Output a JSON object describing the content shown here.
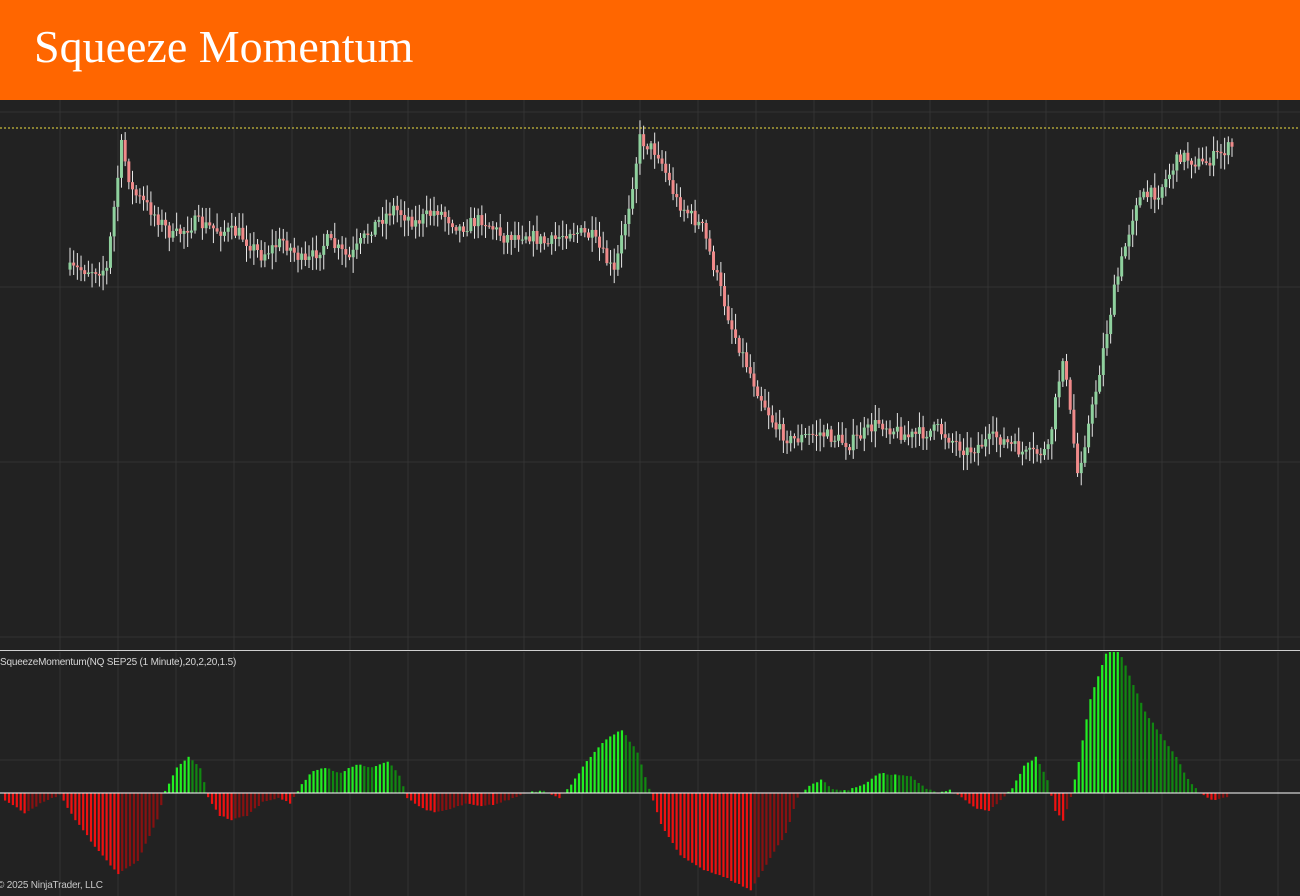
{
  "header": {
    "title": "Squeeze Momentum"
  },
  "indicator": {
    "label": "SqueezeMomentum(NQ SEP25 (1 Minute),20,2,20,1.5)"
  },
  "footer": {
    "copyright": "© 2025 NinjaTrader, LLC"
  },
  "colors": {
    "title_bar": "#ff6600",
    "background": "#222222",
    "grid": "#333333",
    "candle_up": "#8fd19e",
    "candle_down": "#f08a8a",
    "wick": "#e8e8e8",
    "reference_line": "#f0e040",
    "momentum_up_strong": "#22ee22",
    "momentum_up_weak": "#118811",
    "momentum_down_strong": "#ee1111",
    "momentum_down_weak": "#881111",
    "zero_line": "#ffffff"
  },
  "chart_data": [
    {
      "type": "candlestick",
      "symbol_interval": "1 Minute",
      "shape_keypoints": [
        [
          0,
          0.78
        ],
        [
          10,
          0.78
        ],
        [
          14,
          0.1
        ],
        [
          17,
          0.35
        ],
        [
          22,
          0.45
        ],
        [
          28,
          0.6
        ],
        [
          34,
          0.52
        ],
        [
          40,
          0.56
        ],
        [
          46,
          0.58
        ],
        [
          52,
          0.7
        ],
        [
          58,
          0.62
        ],
        [
          64,
          0.75
        ],
        [
          70,
          0.62
        ],
        [
          76,
          0.72
        ],
        [
          82,
          0.55
        ],
        [
          88,
          0.44
        ],
        [
          94,
          0.52
        ],
        [
          100,
          0.45
        ],
        [
          106,
          0.55
        ],
        [
          112,
          0.5
        ],
        [
          118,
          0.6
        ],
        [
          124,
          0.58
        ],
        [
          130,
          0.64
        ],
        [
          136,
          0.56
        ],
        [
          142,
          0.6
        ],
        [
          148,
          0.8
        ],
        [
          152,
          0.42
        ],
        [
          155,
          0.06
        ],
        [
          160,
          0.14
        ],
        [
          165,
          0.4
        ],
        [
          172,
          0.55
        ],
        [
          180,
          1.1
        ],
        [
          186,
          1.4
        ],
        [
          192,
          1.65
        ],
        [
          196,
          1.72
        ],
        [
          204,
          1.68
        ],
        [
          212,
          1.74
        ],
        [
          220,
          1.62
        ],
        [
          228,
          1.7
        ],
        [
          236,
          1.66
        ],
        [
          244,
          1.78
        ],
        [
          252,
          1.7
        ],
        [
          260,
          1.8
        ],
        [
          266,
          1.78
        ],
        [
          270,
          1.25
        ],
        [
          274,
          1.9
        ],
        [
          278,
          1.55
        ],
        [
          284,
          0.9
        ],
        [
          290,
          0.4
        ],
        [
          296,
          0.35
        ],
        [
          302,
          0.15
        ],
        [
          308,
          0.2
        ],
        [
          316,
          0.1
        ]
      ],
      "reference_line": {
        "level_ratio": 0.0
      }
    },
    {
      "type": "bar",
      "series": [
        {
          "name": "SqueezeMomentum"
        }
      ],
      "zero_line": true,
      "shape_keypoints": [
        [
          0,
          -0.08
        ],
        [
          5,
          -0.22
        ],
        [
          9,
          -0.12
        ],
        [
          14,
          -0.02
        ],
        [
          18,
          -0.3
        ],
        [
          24,
          -0.65
        ],
        [
          29,
          -0.9
        ],
        [
          34,
          -0.75
        ],
        [
          39,
          -0.3
        ],
        [
          41,
          0.02
        ],
        [
          44,
          0.28
        ],
        [
          47,
          0.4
        ],
        [
          50,
          0.28
        ],
        [
          52,
          -0.05
        ],
        [
          55,
          -0.25
        ],
        [
          58,
          -0.3
        ],
        [
          62,
          -0.25
        ],
        [
          66,
          -0.1
        ],
        [
          70,
          -0.05
        ],
        [
          73,
          -0.12
        ],
        [
          76,
          0.1
        ],
        [
          79,
          0.25
        ],
        [
          82,
          0.28
        ],
        [
          86,
          0.22
        ],
        [
          90,
          0.32
        ],
        [
          94,
          0.28
        ],
        [
          98,
          0.35
        ],
        [
          101,
          0.2
        ],
        [
          103,
          -0.05
        ],
        [
          106,
          -0.15
        ],
        [
          110,
          -0.22
        ],
        [
          114,
          -0.18
        ],
        [
          118,
          -0.12
        ],
        [
          122,
          -0.15
        ],
        [
          126,
          -0.12
        ],
        [
          130,
          -0.06
        ],
        [
          134,
          0.01
        ],
        [
          138,
          0.03
        ],
        [
          142,
          -0.06
        ],
        [
          145,
          0.1
        ],
        [
          149,
          0.35
        ],
        [
          154,
          0.6
        ],
        [
          158,
          0.7
        ],
        [
          162,
          0.45
        ],
        [
          165,
          0.05
        ],
        [
          168,
          -0.35
        ],
        [
          173,
          -0.7
        ],
        [
          179,
          -0.85
        ],
        [
          185,
          -0.95
        ],
        [
          191,
          -1.08
        ],
        [
          196,
          -0.72
        ],
        [
          200,
          -0.45
        ],
        [
          203,
          -0.05
        ],
        [
          206,
          0.08
        ],
        [
          209,
          0.15
        ],
        [
          212,
          0.04
        ],
        [
          216,
          0.03
        ],
        [
          220,
          0.1
        ],
        [
          224,
          0.22
        ],
        [
          228,
          0.2
        ],
        [
          232,
          0.18
        ],
        [
          236,
          0.05
        ],
        [
          239,
          0.0
        ],
        [
          242,
          0.03
        ],
        [
          245,
          -0.05
        ],
        [
          249,
          -0.18
        ],
        [
          252,
          -0.2
        ],
        [
          255,
          -0.08
        ],
        [
          258,
          0.05
        ],
        [
          261,
          0.3
        ],
        [
          264,
          0.4
        ],
        [
          267,
          0.15
        ],
        [
          269,
          -0.2
        ],
        [
          271,
          -0.3
        ],
        [
          273,
          -0.05
        ],
        [
          275,
          0.35
        ],
        [
          278,
          1.05
        ],
        [
          282,
          1.55
        ],
        [
          285,
          1.62
        ],
        [
          289,
          1.2
        ],
        [
          292,
          0.9
        ],
        [
          296,
          0.65
        ],
        [
          300,
          0.4
        ],
        [
          303,
          0.15
        ],
        [
          306,
          0.0
        ],
        [
          309,
          -0.08
        ],
        [
          313,
          -0.05
        ]
      ]
    }
  ]
}
